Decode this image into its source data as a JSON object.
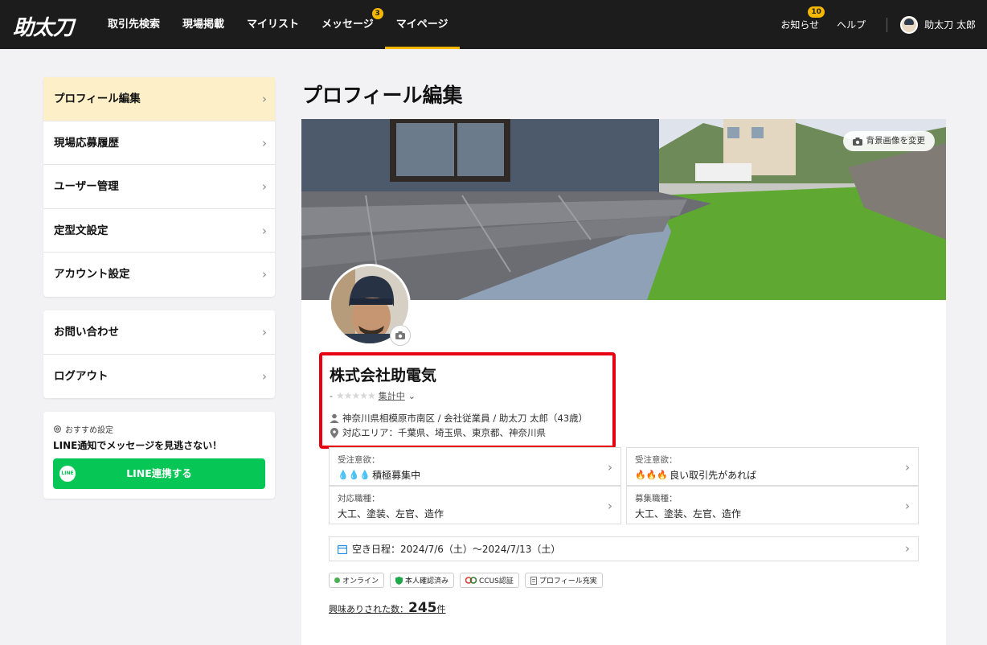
{
  "header": {
    "logo": "助太刀",
    "nav": [
      {
        "label": "取引先検索"
      },
      {
        "label": "現場掲載"
      },
      {
        "label": "マイリスト"
      },
      {
        "label": "メッセージ",
        "badge": "3"
      },
      {
        "label": "マイページ",
        "active": true
      }
    ],
    "notifications_label": "お知らせ",
    "notifications_badge": "10",
    "help_label": "ヘルプ",
    "user_name": "助太刀 太郎"
  },
  "sidebar": {
    "menu": [
      "プロフィール編集",
      "現場応募履歴",
      "ユーザー管理",
      "定型文設定",
      "アカウント設定"
    ],
    "menu2": [
      "お問い合わせ",
      "ログアウト"
    ],
    "promo": {
      "label": "おすすめ設定",
      "title": "LINE通知でメッセージを見逃さない！",
      "button": "LINE連携する",
      "button_icon_text": "LINE"
    }
  },
  "page_title": "プロフィール編集",
  "profile": {
    "bg_button": "背景画像を変更",
    "company": "株式会社助電気",
    "rating_prefix": "-",
    "rating_stars": "★★★★★",
    "rating_label": "集計中",
    "location": "神奈川県相模原市南区 / 会社従業員 / 助太刀 太郎（43歳）",
    "area": "対応エリア：千葉県、埼玉県、東京都、神奈川県",
    "boxes": [
      {
        "label": "受注意欲：",
        "icon": "💧💧💧",
        "value": "積極募集中"
      },
      {
        "label": "受注意欲：",
        "icon": "🔥🔥🔥",
        "value": "良い取引先があれば"
      },
      {
        "label": "対応職種：",
        "value": "大工、塗装、左官、造作"
      },
      {
        "label": "募集職種：",
        "value": "大工、塗装、左官、造作"
      }
    ],
    "schedule": "空き日程：2024/7/6（土）〜2024/7/13（土）",
    "tags": [
      "オンライン",
      "本人確認済み",
      "CCUS認証",
      "プロフィール充実"
    ],
    "interest_prefix": "興味ありされた数：",
    "interest_count": "245",
    "interest_suffix": "件"
  }
}
